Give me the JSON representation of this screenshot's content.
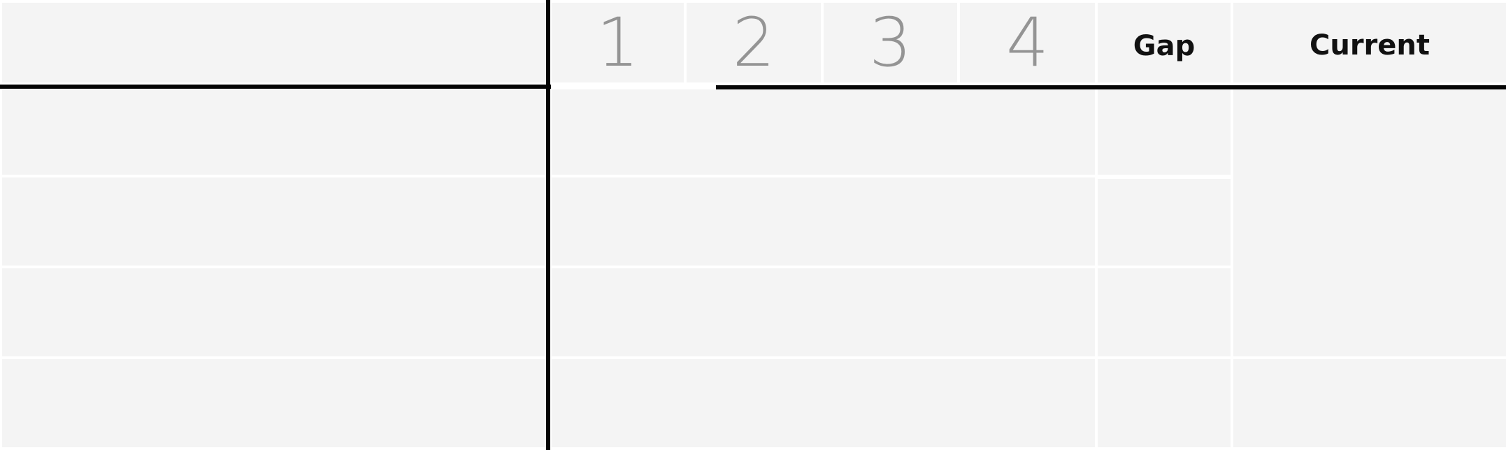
{
  "header": {
    "level_1": "1",
    "level_2": "2",
    "level_3": "3",
    "level_4": "4",
    "gap_label": "Gap",
    "current_label": "Current"
  },
  "rows": [
    {
      "criterion": "",
      "gap": "",
      "current": ""
    },
    {
      "criterion": "",
      "gap": "",
      "current": ""
    },
    {
      "criterion": "",
      "gap": "",
      "current": ""
    },
    {
      "criterion": "",
      "gap": "",
      "current": ""
    }
  ],
  "colors": {
    "cell_background": "#f4f4f4",
    "grid_line": "#ffffff",
    "rule": "#050505",
    "level_number": "#949494",
    "header_text": "#111111"
  }
}
